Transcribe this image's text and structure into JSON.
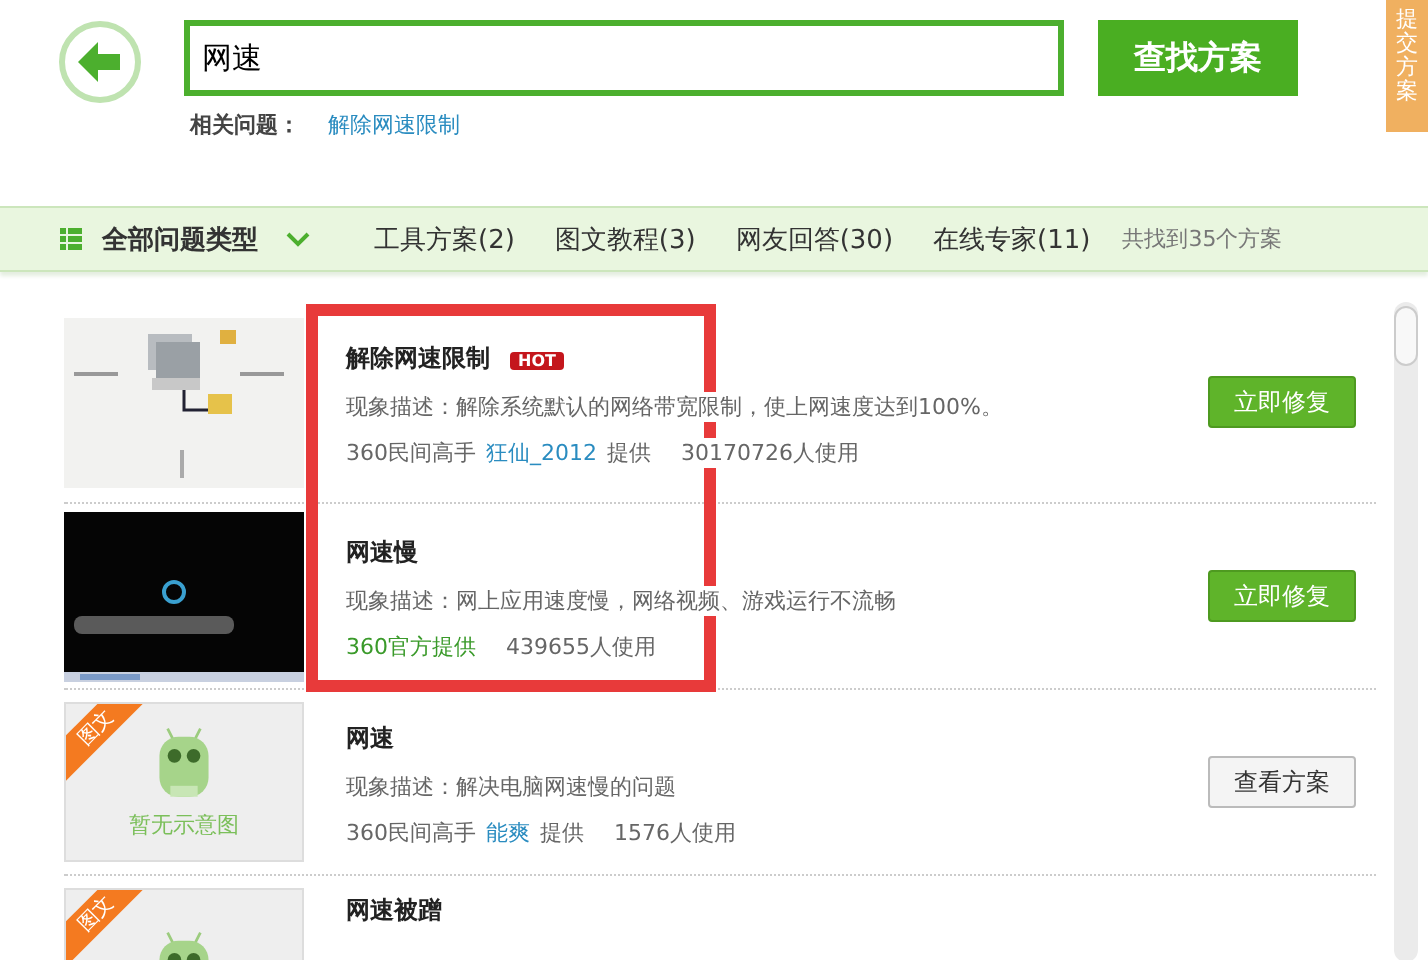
{
  "search": {
    "value": "网速",
    "button": "查找方案"
  },
  "submit_tab": "提交方案",
  "related": {
    "label": "相关问题：",
    "link": "解除网速限制"
  },
  "filter": {
    "all_types": "全部问题类型",
    "tabs": [
      {
        "label": "工具方案(2)"
      },
      {
        "label": "图文教程(3)"
      },
      {
        "label": "网友回答(30)"
      },
      {
        "label": "在线专家(11)"
      }
    ],
    "total": "共找到35个方案"
  },
  "results": [
    {
      "kind": "tool",
      "title": "解除网速限制",
      "badge": "HOT",
      "desc": "现象描述：解除系统默认的网络带宽限制，使上网速度达到100%。",
      "provider": {
        "kind": "user",
        "prefix": "360民间高手",
        "name": "狂仙_2012",
        "suffix": "提供"
      },
      "usage": "30170726人使用",
      "button": "立即修复"
    },
    {
      "kind": "tool",
      "title": "网速慢",
      "desc": "现象描述：网上应用速度慢，网络视频、游戏运行不流畅",
      "provider": {
        "kind": "official",
        "text": "360官方提供"
      },
      "usage": "439655人使用",
      "button": "立即修复"
    },
    {
      "kind": "article",
      "ribbon": "图文",
      "thumb_text": "暂无示意图",
      "title": "网速",
      "desc": "现象描述：解决电脑网速慢的问题",
      "provider": {
        "kind": "user",
        "prefix": "360民间高手",
        "name": "能爽",
        "suffix": "提供"
      },
      "usage": "1576人使用",
      "button": "查看方案"
    },
    {
      "kind": "article",
      "ribbon": "图文",
      "title": "网速被蹭"
    }
  ]
}
